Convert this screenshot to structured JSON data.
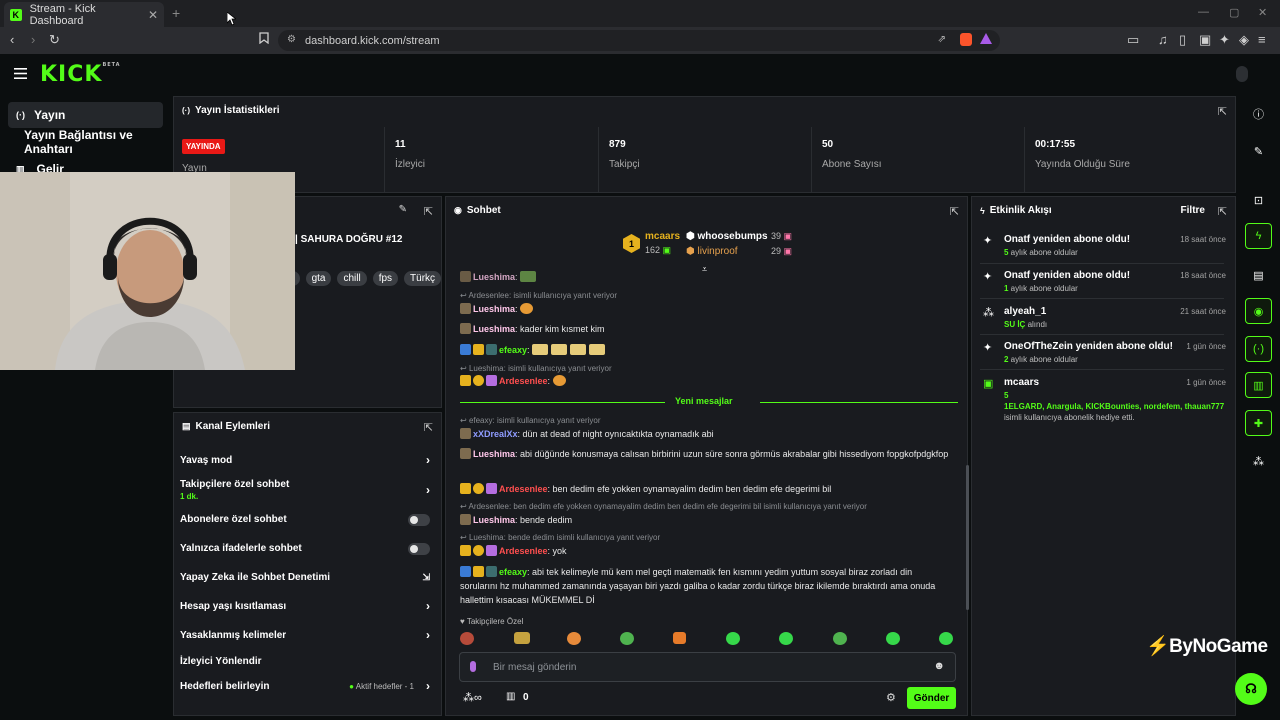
{
  "browser": {
    "tab_title": "Stream - Kick Dashboard",
    "tab_close": "✕",
    "new_tab": "+",
    "url": "dashboard.kick.com/stream"
  },
  "header": {
    "logo": "KICK",
    "logo_beta": "BETA"
  },
  "sidebar": {
    "items": [
      "Yayın",
      "Yayın Bağlantısı ve Anahtarı",
      "Gelir"
    ]
  },
  "stats": {
    "title": "Yayın İstatistikleri",
    "live_badge": "YAYINDA",
    "items": [
      {
        "value": "",
        "label": "Yayın"
      },
      {
        "value": "11",
        "label": "İzleyici"
      },
      {
        "value": "879",
        "label": "Takipçi"
      },
      {
        "value": "50",
        "label": "Abone Sayısı"
      },
      {
        "value": "00:17:55",
        "label": "Yayında Olduğu Süre"
      }
    ]
  },
  "stream_info": {
    "title": "| SAHURA DOĞRU #12",
    "tags": [
      "n",
      "gta",
      "chill",
      "fps",
      "Türkç"
    ]
  },
  "channel_actions": {
    "title": "Kanal Eylemleri",
    "items": [
      {
        "label": "Yavaş mod",
        "sub": "",
        "control": "chevron"
      },
      {
        "label": "Takipçilere özel sohbet",
        "sub": "1 dk.",
        "control": "chevron"
      },
      {
        "label": "Abonelere özel sohbet",
        "sub": "",
        "control": "toggle"
      },
      {
        "label": "Yalnızca ifadelerle sohbet",
        "sub": "",
        "control": "toggle"
      },
      {
        "label": "Yapay Zeka ile Sohbet Denetimi",
        "sub": "",
        "control": "external"
      },
      {
        "label": "Hesap yaşı kısıtlaması",
        "sub": "",
        "control": "chevron"
      },
      {
        "label": "Yasaklanmış kelimeler",
        "sub": "",
        "control": "chevron"
      },
      {
        "label": "İzleyici Yönlendir",
        "sub": "",
        "control": "none"
      },
      {
        "label": "Hedefleri belirleyin",
        "sub": "",
        "control": "chevron"
      }
    ],
    "goals_status": "Aktif hedefler - 1"
  },
  "chat": {
    "title": "Sohbet",
    "leaderboard": {
      "first_rank": "1",
      "first_name": "mcaars",
      "first_count": "162",
      "second_name": "whoosebumps",
      "second_count": "39",
      "third_name": "livinproof",
      "third_count": "29"
    },
    "new_messages": "Yeni mesajlar",
    "messages": [
      {
        "reply": "",
        "user": "Lueshima",
        "user_color": "#ffc7ea",
        "text": ""
      },
      {
        "reply": "Ardesenlee: isimli kullanıcıya yanıt veriyor",
        "user": "Lueshima",
        "user_color": "#ffc7ea",
        "text": ""
      },
      {
        "reply": "",
        "user": "Lueshima",
        "user_color": "#ffc7ea",
        "text": "kader kim kısmet kim"
      },
      {
        "reply": "",
        "user": "efeaxy",
        "user_color": "#53fc18",
        "text": ""
      },
      {
        "reply": "Lueshima: isimli kullanıcıya yanıt veriyor",
        "user": "Ardesenlee",
        "user_color": "#ff4f4f",
        "text": ""
      },
      {
        "reply": "efeaxy: isimli kullanıcıya yanıt veriyor",
        "user": "xXDrealXx",
        "user_color": "#8f9cff",
        "text": "dün at dead of night oynıcaktıkta oynamadık abi"
      },
      {
        "reply": "",
        "user": "Lueshima",
        "user_color": "#ffc7ea",
        "text": "abi düğünde konusmaya calısan birbirini uzun süre sonra görmüs akrabalar gibi hissediyom fopgkofpdgkfop"
      },
      {
        "reply": "",
        "user": "Ardesenlee",
        "user_color": "#ff4f4f",
        "text": "ben dedim efe yokken oynamayalim dedim ben dedim efe degerimi bil"
      },
      {
        "reply": "Ardesenlee: ben dedim efe yokken oynamayalim dedim ben dedim efe degerimi bil isimli kullanıcıya yanıt veriyor",
        "user": "Lueshima",
        "user_color": "#ffc7ea",
        "text": "bende dedim"
      },
      {
        "reply": "Lueshima: bende dedim isimli kullanıcıya yanıt veriyor",
        "user": "Ardesenlee",
        "user_color": "#ff4f4f",
        "text": "yok"
      },
      {
        "reply": "",
        "user": "efeaxy",
        "user_color": "#53fc18",
        "text": "abi tek kelimeyle mü kem mel geçti matematik fen kısmını yedim yuttum sosyal biraz zorladı din sorularını hz muhammed zamanında yaşayan biri yazdı galiba o kadar zordu türkçe biraz ikilemde bıraktırdı ama onuda hallettim kısacası MÜKEMMEL Dİ"
      }
    ],
    "emote_section": "Takipçilere Özel",
    "input_placeholder": "Bir mesaj gönderin",
    "points": "0",
    "send_label": "Gönder"
  },
  "activity": {
    "title": "Etkinlik Akışı",
    "filter_label": "Filtre",
    "events": [
      {
        "title": "Onatf yeniden abone oldu!",
        "num": "5",
        "sub": " aylık abone oldular",
        "time": "18 saat önce"
      },
      {
        "title": "Onatf yeniden abone oldu!",
        "num": "1",
        "sub": " aylık abone oldular",
        "time": "18 saat önce"
      },
      {
        "title": "alyeah_1",
        "num": "SU İÇ",
        "sub": " alındı",
        "time": "21 saat önce"
      },
      {
        "title": "OneOfTheZein yeniden abone oldu!",
        "num": "2",
        "sub": " aylık abone oldular",
        "time": "1 gün önce"
      },
      {
        "title": "mcaars",
        "num": "5",
        "sub": "",
        "time": "1 gün önce"
      }
    ],
    "gift_list": "1ELGARD, Anargula, KICKBounties, nordefem, thauan777",
    "gift_text": "isimli kullanıcıya abonelik hediye etti."
  },
  "watermark": "ByNoGame",
  "colors": {
    "accent": "#53fc18",
    "live": "#e91916",
    "panel": "#191b1f",
    "background": "#0b0e0f"
  }
}
